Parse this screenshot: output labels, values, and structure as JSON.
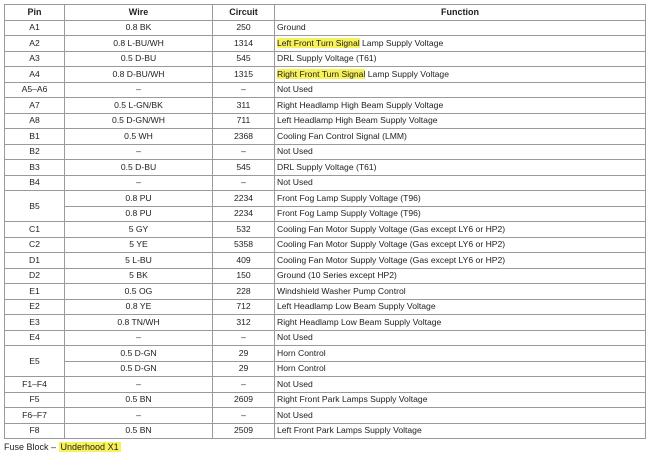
{
  "table": {
    "headers": [
      "Pin",
      "Wire",
      "Circuit",
      "Function"
    ],
    "rows": [
      {
        "pin": "A1",
        "wire": "0.8 BK",
        "circuit": "250",
        "function": "Ground"
      },
      {
        "pin": "A2",
        "wire": "0.8 L-BU/WH",
        "circuit": "1314",
        "function_highlight": "Left Front Turn Signal",
        "function_rest": " Lamp Supply Voltage"
      },
      {
        "pin": "A3",
        "wire": "0.5 D-BU",
        "circuit": "545",
        "function": "DRL Supply Voltage (T61)"
      },
      {
        "pin": "A4",
        "wire": "0.8 D-BU/WH",
        "circuit": "1315",
        "function_highlight": "Right Front Turn Signal",
        "function_rest": " Lamp Supply Voltage"
      },
      {
        "pin": "A5–A6",
        "wire": "–",
        "circuit": "–",
        "function": "Not Used"
      },
      {
        "pin": "A7",
        "wire": "0.5 L-GN/BK",
        "circuit": "311",
        "function": "Right Headlamp High Beam Supply Voltage"
      },
      {
        "pin": "A8",
        "wire": "0.5 D-GN/WH",
        "circuit": "711",
        "function": "Left Headlamp High Beam Supply Voltage"
      },
      {
        "pin": "B1",
        "wire": "0.5 WH",
        "circuit": "2368",
        "function": "Cooling Fan Control Signal (LMM)"
      },
      {
        "pin": "B2",
        "wire": "–",
        "circuit": "–",
        "function": "Not Used"
      },
      {
        "pin": "B3",
        "wire": "0.5 D-BU",
        "circuit": "545",
        "function": "DRL Supply Voltage (T61)"
      },
      {
        "pin": "B4",
        "wire": "–",
        "circuit": "–",
        "function": "Not Used"
      },
      {
        "pin": "B5",
        "wire": "0.8 PU",
        "circuit": "2234",
        "function": "Front Fog Lamp Supply Voltage (T96)"
      },
      {
        "pin": "",
        "wire": "0.8 PU",
        "circuit": "2234",
        "function": "Front Fog Lamp Supply Voltage (T96)"
      },
      {
        "pin": "C1",
        "wire": "5 GY",
        "circuit": "532",
        "function": "Cooling Fan Motor Supply Voltage (Gas except LY6 or HP2)"
      },
      {
        "pin": "C2",
        "wire": "5 YE",
        "circuit": "5358",
        "function": "Cooling Fan Motor Supply Voltage (Gas except LY6 or HP2)"
      },
      {
        "pin": "D1",
        "wire": "5 L-BU",
        "circuit": "409",
        "function": "Cooling Fan Motor Supply Voltage (Gas except LY6 or HP2)"
      },
      {
        "pin": "D2",
        "wire": "5 BK",
        "circuit": "150",
        "function": "Ground (10 Series except HP2)"
      },
      {
        "pin": "E1",
        "wire": "0.5 OG",
        "circuit": "228",
        "function": "Windshield Washer Pump Control"
      },
      {
        "pin": "E2",
        "wire": "0.8 YE",
        "circuit": "712",
        "function": "Left Headlamp Low Beam Supply Voltage"
      },
      {
        "pin": "E3",
        "wire": "0.8 TN/WH",
        "circuit": "312",
        "function": "Right Headlamp Low Beam Supply Voltage"
      },
      {
        "pin": "E4",
        "wire": "–",
        "circuit": "–",
        "function": "Not Used"
      },
      {
        "pin": "E5",
        "wire": "0.5 D-GN",
        "circuit": "29",
        "function": "Horn Control"
      },
      {
        "pin": "",
        "wire": "0.5 D-GN",
        "circuit": "29",
        "function": "Horn Control"
      },
      {
        "pin": "F1–F4",
        "wire": "–",
        "circuit": "–",
        "function": "Not Used"
      },
      {
        "pin": "F5",
        "wire": "0.5 BN",
        "circuit": "2609",
        "function": "Right Front Park Lamps Supply Voltage"
      },
      {
        "pin": "F6–F7",
        "wire": "–",
        "circuit": "–",
        "function": "Not Used"
      },
      {
        "pin": "F8",
        "wire": "0.5 BN",
        "circuit": "2509",
        "function": "Left Front Park Lamps Supply Voltage"
      }
    ]
  },
  "footer": {
    "prefix": "Fuse Block – ",
    "highlight": "Underhood X1"
  },
  "colors": {
    "highlight": "#f7f25a",
    "border": "#9a9a9a"
  }
}
